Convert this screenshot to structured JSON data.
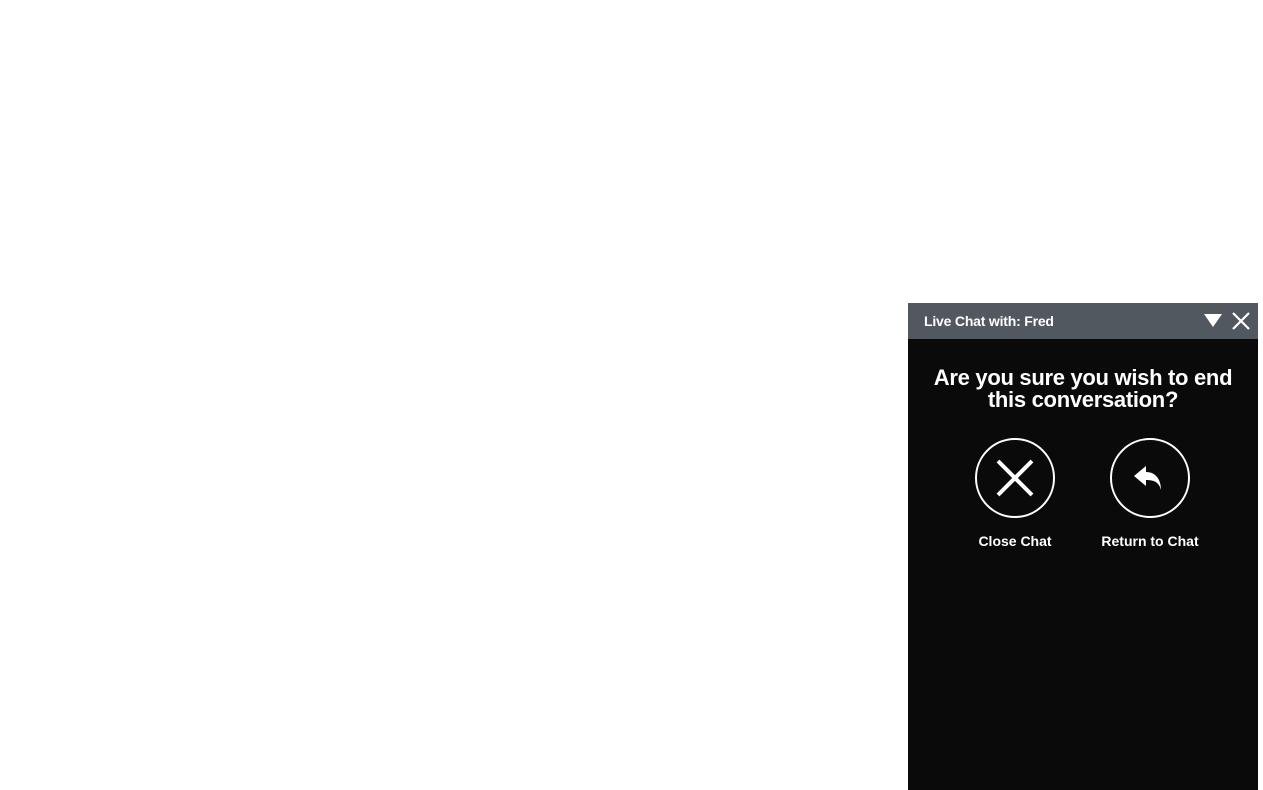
{
  "chat": {
    "header": {
      "title": "Live Chat with: Fred"
    },
    "confirm": {
      "question": "Are you sure you wish to end this conversation?",
      "close_label": "Close Chat",
      "return_label": "Return to Chat"
    }
  },
  "colors": {
    "header_bg": "#525860",
    "overlay_bg": "#000000",
    "text": "#ffffff"
  },
  "icons": {
    "minimize": "triangle-down-icon",
    "close": "close-icon",
    "close_chat": "x-icon",
    "return_chat": "reply-arrow-icon"
  }
}
